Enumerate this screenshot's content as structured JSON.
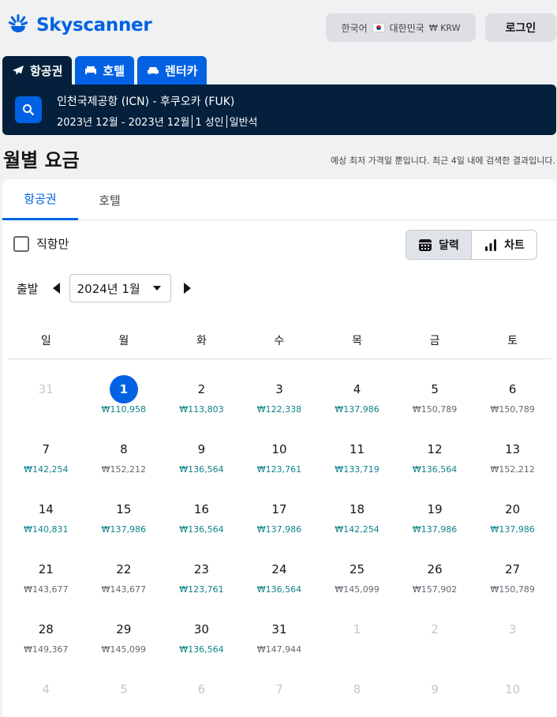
{
  "header": {
    "brand": "Skyscanner",
    "language": "한국어",
    "country": "대한민국",
    "currency": "₩ KRW",
    "login": "로그인"
  },
  "tabs": [
    {
      "label": "항공권",
      "icon": "plane-icon",
      "active": true
    },
    {
      "label": "호텔",
      "icon": "bed-icon",
      "active": false
    },
    {
      "label": "렌터카",
      "icon": "car-icon",
      "active": false
    }
  ],
  "summary": {
    "route": "인천국제공항 (ICN) - 후쿠오카 (FUK)",
    "dates": "2023년 12월 - 2023년 12월",
    "travelers": "1 성인",
    "cabin": "일반석"
  },
  "page": {
    "title": "월별 요금",
    "note": "예상 최저 가격일 뿐입니다. 최근 4일 내에 검색한 결과입니다."
  },
  "inner_tabs": [
    {
      "label": "항공권",
      "active": true
    },
    {
      "label": "호텔",
      "active": false
    }
  ],
  "filters": {
    "direct_only": "직항만",
    "calendar_view": "달력",
    "chart_view": "차트"
  },
  "month_picker": {
    "label": "출발",
    "selected": "2024년 1월"
  },
  "weekdays": [
    "일",
    "월",
    "화",
    "수",
    "목",
    "금",
    "토"
  ],
  "days": [
    {
      "d": "31",
      "price": "",
      "off": true
    },
    {
      "d": "1",
      "price": "₩110,958",
      "low": true,
      "selected": true
    },
    {
      "d": "2",
      "price": "₩113,803",
      "low": true
    },
    {
      "d": "3",
      "price": "₩122,338",
      "low": true
    },
    {
      "d": "4",
      "price": "₩137,986",
      "low": true
    },
    {
      "d": "5",
      "price": "₩150,789",
      "low": false
    },
    {
      "d": "6",
      "price": "₩150,789",
      "low": false
    },
    {
      "d": "7",
      "price": "₩142,254",
      "low": true
    },
    {
      "d": "8",
      "price": "₩152,212",
      "low": false
    },
    {
      "d": "9",
      "price": "₩136,564",
      "low": true
    },
    {
      "d": "10",
      "price": "₩123,761",
      "low": true
    },
    {
      "d": "11",
      "price": "₩133,719",
      "low": true
    },
    {
      "d": "12",
      "price": "₩136,564",
      "low": true
    },
    {
      "d": "13",
      "price": "₩152,212",
      "low": false
    },
    {
      "d": "14",
      "price": "₩140,831",
      "low": true
    },
    {
      "d": "15",
      "price": "₩137,986",
      "low": true
    },
    {
      "d": "16",
      "price": "₩136,564",
      "low": true
    },
    {
      "d": "17",
      "price": "₩137,986",
      "low": true
    },
    {
      "d": "18",
      "price": "₩142,254",
      "low": true
    },
    {
      "d": "19",
      "price": "₩137,986",
      "low": true
    },
    {
      "d": "20",
      "price": "₩137,986",
      "low": true
    },
    {
      "d": "21",
      "price": "₩143,677",
      "low": false
    },
    {
      "d": "22",
      "price": "₩143,677",
      "low": false
    },
    {
      "d": "23",
      "price": "₩123,761",
      "low": true
    },
    {
      "d": "24",
      "price": "₩136,564",
      "low": true
    },
    {
      "d": "25",
      "price": "₩145,099",
      "low": false
    },
    {
      "d": "26",
      "price": "₩157,902",
      "low": false
    },
    {
      "d": "27",
      "price": "₩150,789",
      "low": false
    },
    {
      "d": "28",
      "price": "₩149,367",
      "low": false
    },
    {
      "d": "29",
      "price": "₩145,099",
      "low": false
    },
    {
      "d": "30",
      "price": "₩136,564",
      "low": true
    },
    {
      "d": "31",
      "price": "₩147,944",
      "low": false
    },
    {
      "d": "1",
      "price": "",
      "off": true
    },
    {
      "d": "2",
      "price": "",
      "off": true
    },
    {
      "d": "3",
      "price": "",
      "off": true
    },
    {
      "d": "4",
      "price": "",
      "off": true
    },
    {
      "d": "5",
      "price": "",
      "off": true
    },
    {
      "d": "6",
      "price": "",
      "off": true
    },
    {
      "d": "7",
      "price": "",
      "off": true
    },
    {
      "d": "8",
      "price": "",
      "off": true
    },
    {
      "d": "9",
      "price": "",
      "off": true
    },
    {
      "d": "10",
      "price": "",
      "off": true
    }
  ],
  "colors": {
    "brand": "#0062e3",
    "navy": "#05203c",
    "low_price": "#0c838a",
    "normal_price": "#626971"
  }
}
